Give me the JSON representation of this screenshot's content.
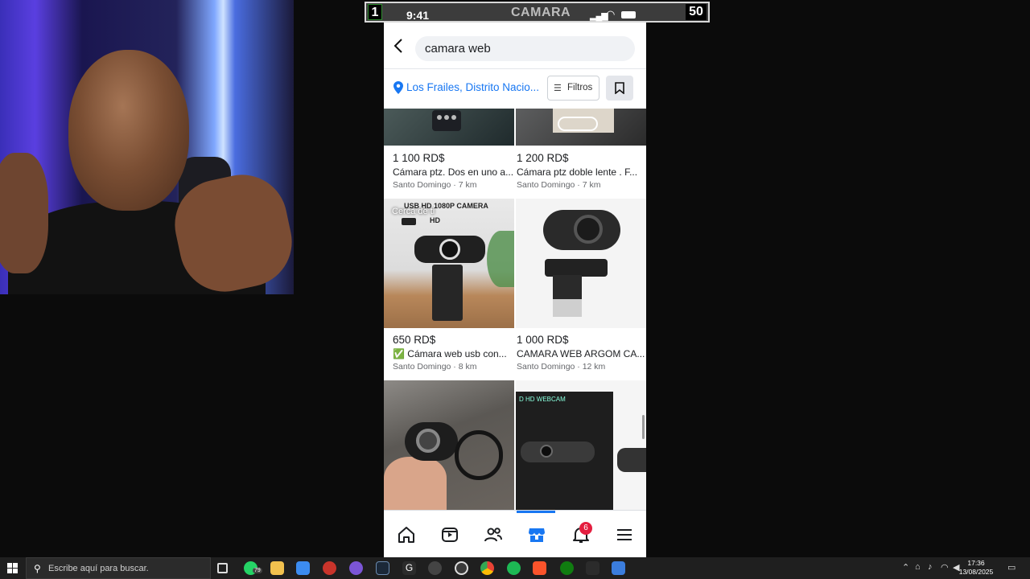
{
  "statusbar": {
    "left_counter": "1",
    "time": "9:41",
    "title": "CAMARA",
    "right_counter": "50"
  },
  "search": {
    "back_icon": "chevron-left-icon",
    "query": "camara web"
  },
  "location": {
    "icon": "location-pin-icon",
    "text": "Los Frailes, Distrito Nacio...",
    "filters_label": "Filtros",
    "bookmark_icon": "bookmark-icon"
  },
  "listings": [
    {
      "price": "1 100 RD$",
      "title": "Cámara ptz. Dos en uno a...",
      "location": "Santo Domingo · 7 km"
    },
    {
      "price": "1 200 RD$",
      "title": "Cámara ptz doble lente . F...",
      "location": "Santo Domingo · 7 km"
    },
    {
      "price": "650 RD$",
      "title": "✅ Cámara web usb con...",
      "location": "Santo Domingo · 8 km",
      "badge": "Cerca de ti"
    },
    {
      "price": "1 000 RD$",
      "title": "CAMARA WEB ARGOM CA...",
      "location": "Santo Domingo · 12 km"
    },
    {
      "price": "",
      "title": "",
      "location": ""
    },
    {
      "price": "",
      "title": "",
      "location": ""
    }
  ],
  "thumb_labels": {
    "usb_cam_header": "USB HD 1080P CAMERA",
    "usb_cam_hd": "HD",
    "hd_webcam": "D HD WEBCAM"
  },
  "tabbar": {
    "items": [
      "home-icon",
      "video-icon",
      "friends-icon",
      "marketplace-icon",
      "notifications-icon",
      "menu-icon"
    ],
    "active": "marketplace-icon",
    "notifications_count": "6"
  },
  "taskbar": {
    "search_placeholder": "Escribe aquí para buscar.",
    "whatsapp_count": "79",
    "time": "17:36",
    "date": "13/08/2025",
    "accent": "#1877f2"
  }
}
